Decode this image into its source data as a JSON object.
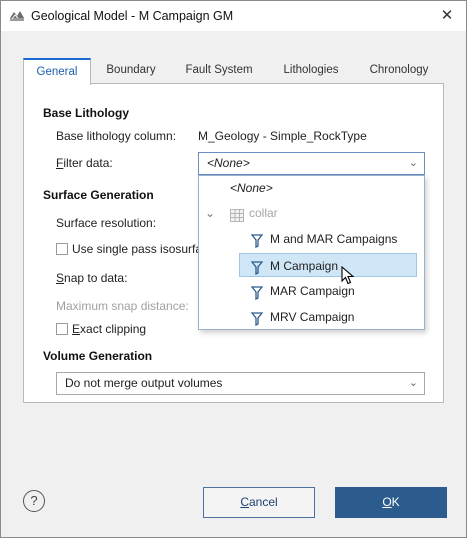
{
  "window": {
    "title": "Geological Model - M Campaign GM"
  },
  "tabs": [
    {
      "label": "General",
      "active": true
    },
    {
      "label": "Boundary",
      "active": false
    },
    {
      "label": "Fault System",
      "active": false
    },
    {
      "label": "Lithologies",
      "active": false
    },
    {
      "label": "Chronology",
      "active": false
    }
  ],
  "base_lithology": {
    "title": "Base Lithology",
    "column_label": "Base lithology column:",
    "column_value": "M_Geology - Simple_RockType",
    "filter_label": "Filter data:",
    "filter_value": "<None>"
  },
  "surface_generation": {
    "title": "Surface Generation",
    "resolution_label": "Surface resolution:",
    "single_pass_label": "Use single pass isosurfa",
    "snap_label": "Snap to data:",
    "max_snap_label": "Maximum snap distance:",
    "exact_clipping_label": "Exact clipping"
  },
  "volume_generation": {
    "title": "Volume Generation",
    "merge_value": "Do not merge output volumes"
  },
  "dropdown": {
    "none_option": "<None>",
    "group_label": "collar",
    "options": [
      "M and MAR Campaigns",
      "M Campaign",
      "MAR Campaign",
      "MRV Campaign"
    ],
    "selected": "M Campaign"
  },
  "footer": {
    "help": "?",
    "cancel_label": "Cancel",
    "ok_label": "OK"
  },
  "colors": {
    "accent": "#1a6ad1",
    "ok_button": "#2b5c8d",
    "selection": "#cfe6f7"
  }
}
